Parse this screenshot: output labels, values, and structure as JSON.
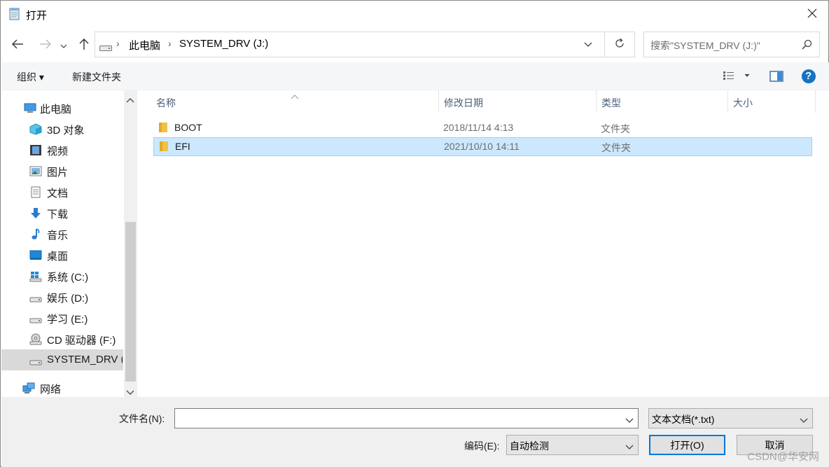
{
  "window": {
    "title": "打开",
    "title_icon": "notepad-icon",
    "close_icon": "close-icon"
  },
  "address": {
    "back_icon": "back-arrow-icon",
    "forward_icon": "forward-arrow-icon",
    "recent_icon": "chevron-down-icon",
    "up_icon": "up-arrow-icon",
    "crumbs": [
      "此电脑",
      "SYSTEM_DRV (J:)"
    ],
    "refresh_icon": "refresh-icon"
  },
  "search": {
    "placeholder": "搜索\"SYSTEM_DRV (J:)\"",
    "icon": "search-icon"
  },
  "toolbar": {
    "organize_label": "组织 ▾",
    "new_folder_label": "新建文件夹",
    "view_icon": "view-details-icon",
    "preview_icon": "preview-pane-icon",
    "help_icon": "help-icon",
    "help_label": "?"
  },
  "nav": {
    "items": [
      {
        "label": "此电脑",
        "icon": "computer-icon"
      },
      {
        "label": "3D 对象",
        "icon": "3d-objects-icon"
      },
      {
        "label": "视频",
        "icon": "video-icon"
      },
      {
        "label": "图片",
        "icon": "pictures-icon"
      },
      {
        "label": "文档",
        "icon": "documents-icon"
      },
      {
        "label": "下载",
        "icon": "download-icon"
      },
      {
        "label": "音乐",
        "icon": "music-icon"
      },
      {
        "label": "桌面",
        "icon": "desktop-icon"
      },
      {
        "label": "系统 (C:)",
        "icon": "windows-drive-icon"
      },
      {
        "label": "娱乐 (D:)",
        "icon": "drive-icon"
      },
      {
        "label": "学习 (E:)",
        "icon": "drive-icon"
      },
      {
        "label": "CD 驱动器 (F:)",
        "icon": "cd-drive-icon"
      },
      {
        "label": "SYSTEM_DRV (J:)",
        "icon": "drive-icon"
      },
      {
        "label": "网络",
        "icon": "network-icon"
      }
    ],
    "selected": "SYSTEM_DRV (J:)"
  },
  "files": {
    "columns": [
      "名称",
      "修改日期",
      "类型",
      "大小"
    ],
    "rows": [
      {
        "name": "BOOT",
        "date": "2018/11/14 4:13",
        "type": "文件夹",
        "size": ""
      },
      {
        "name": "EFI",
        "date": "2021/10/10 14:11",
        "type": "文件夹",
        "size": ""
      }
    ],
    "selected": "EFI"
  },
  "bottom": {
    "filename_label": "文件名(N):",
    "filename_value": "",
    "filetype_value": "文本文档(*.txt)",
    "encoding_label": "编码(E):",
    "encoding_value": "自动检测",
    "open_label": "打开(O)",
    "cancel_label": "取消",
    "watermark": "CSDN@华安网"
  },
  "colors": {
    "accent": "#0078d7",
    "selection_bg": "#cce8ff",
    "selection_border": "#99d1ff",
    "folder": "#f0c04a",
    "help_blue": "#1572c4"
  }
}
